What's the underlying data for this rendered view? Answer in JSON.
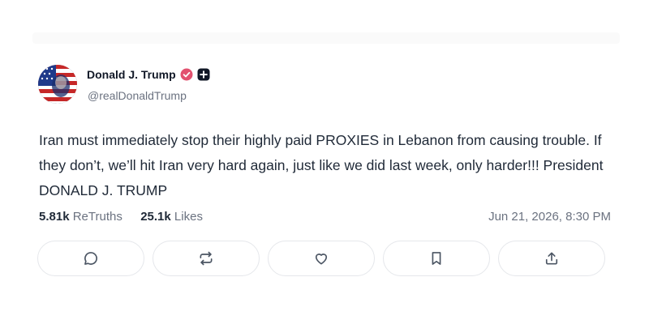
{
  "author": {
    "display_name": "Donald J. Trump",
    "handle": "@realDonaldTrump",
    "avatar_icon": "avatar-flag-portrait",
    "verified_badge_icon": "verified-badge-icon",
    "verified_badge_color": "#e2516f",
    "secondary_badge_icon": "plus-badge-icon"
  },
  "post": {
    "text": "Iran must immediately stop their highly paid PROXIES in Lebanon from causing trouble. If they don’t, we’ll hit Iran very hard again, just like we did last week, only harder!!! President  DONALD J. TRUMP"
  },
  "stats": {
    "retruths_count": "5.81k",
    "retruths_label": "ReTruths",
    "likes_count": "25.1k",
    "likes_label": "Likes",
    "timestamp": "Jun 21, 2026, 8:30 PM"
  },
  "actions": [
    {
      "name": "reply",
      "icon": "comment-icon"
    },
    {
      "name": "retruth",
      "icon": "repost-icon"
    },
    {
      "name": "like",
      "icon": "heart-icon"
    },
    {
      "name": "bookmark",
      "icon": "bookmark-icon"
    },
    {
      "name": "share",
      "icon": "share-icon"
    }
  ]
}
